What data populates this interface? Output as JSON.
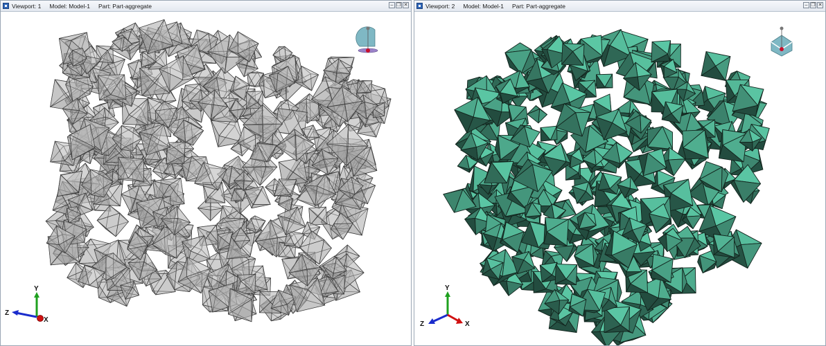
{
  "viewports": [
    {
      "id": "vp1",
      "viewport_label": "Viewport: 1",
      "model_label": "Model: Model-1",
      "part_label": "Part: Part-aggregate",
      "render_mode": "translucent-wireframe",
      "face_color": "#c2c2c2",
      "edge_color": "#3b3b3b",
      "triad": {
        "x": "X",
        "y": "Y",
        "z": "Z"
      },
      "window_buttons": {
        "minimize": "–",
        "restore": "❐",
        "close": "✕"
      }
    },
    {
      "id": "vp2",
      "viewport_label": "Viewport: 2",
      "model_label": "Model: Model-1",
      "part_label": "Part: Part-aggregate",
      "render_mode": "shaded",
      "face_color": "#3f8a72",
      "edge_color": "#12241d",
      "triad": {
        "x": "X",
        "y": "Y",
        "z": "Z"
      },
      "window_buttons": {
        "minimize": "–",
        "restore": "❐",
        "close": "✕"
      }
    }
  ],
  "colors": {
    "axis_x": "#d01010",
    "axis_y": "#1ea01e",
    "axis_z": "#1a2ccc",
    "view_cube": "#7fb8c4"
  },
  "icons": [
    "viewport-window-icon",
    "minimize-icon",
    "restore-icon",
    "close-icon",
    "view-orientation-icon",
    "axis-triad-icon"
  ]
}
